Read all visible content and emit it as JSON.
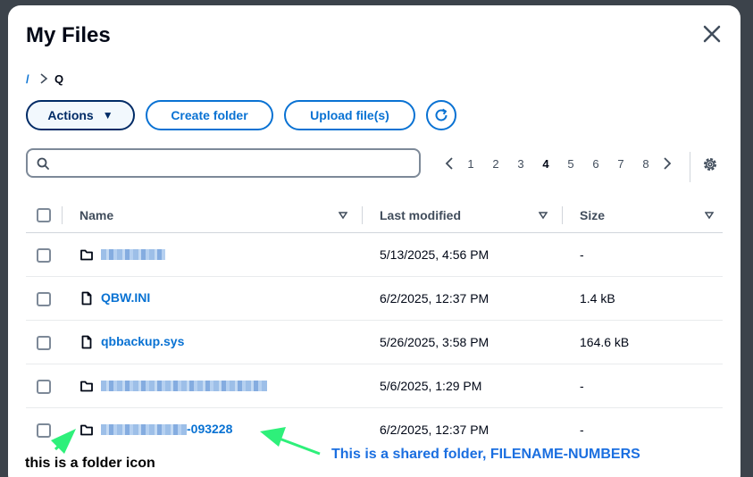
{
  "window": {
    "title": "My Files"
  },
  "breadcrumb": {
    "root": "/",
    "current": "Q"
  },
  "toolbar": {
    "actions_label": "Actions",
    "create_folder_label": "Create folder",
    "upload_label": "Upload file(s)"
  },
  "search": {
    "placeholder": "",
    "value": ""
  },
  "pagination": {
    "pages": [
      "1",
      "2",
      "3",
      "4",
      "5",
      "6",
      "7",
      "8"
    ],
    "current": "4"
  },
  "table": {
    "headers": {
      "name": "Name",
      "modified": "Last modified",
      "size": "Size"
    },
    "rows": [
      {
        "type": "folder",
        "name": "",
        "modified": "5/13/2025, 4:56 PM",
        "size": "-"
      },
      {
        "type": "file",
        "name": "QBW.INI",
        "modified": "6/2/2025, 12:37 PM",
        "size": "1.4 kB"
      },
      {
        "type": "file",
        "name": "qbbackup.sys",
        "modified": "5/26/2025, 3:58 PM",
        "size": "164.6 kB"
      },
      {
        "type": "folder",
        "name": "",
        "modified": "5/6/2025, 1:29 PM",
        "size": "-"
      },
      {
        "type": "folder",
        "name": "-093228",
        "modified": "6/2/2025, 12:37 PM",
        "size": "-"
      }
    ]
  },
  "annotations": {
    "folder_note": "this is a folder icon",
    "shared_note": "This is a shared folder, FILENAME-NUMBERS"
  },
  "colors": {
    "accent": "#0972d3",
    "annotation_arrow": "#2ef07a",
    "annotation_text": "#1b6fe0"
  }
}
